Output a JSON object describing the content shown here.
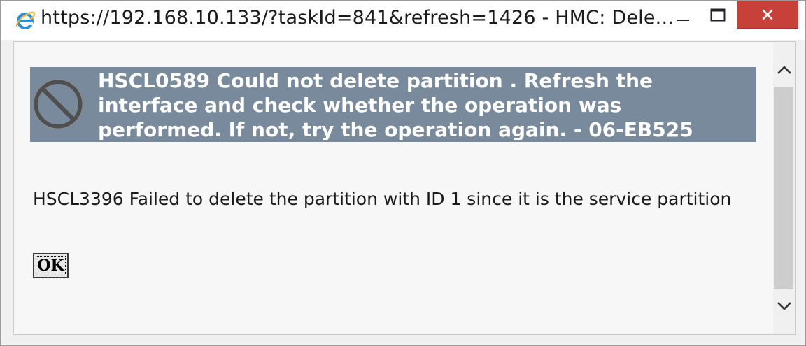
{
  "window": {
    "title": "https://192.168.10.133/?taskId=841&refresh=1426 - HMC: Dele...",
    "browser_icon": "internet-explorer-icon",
    "controls": {
      "minimize_icon": "minimize-icon",
      "maximize_icon": "maximize-icon",
      "close_icon": "close-icon"
    }
  },
  "error": {
    "icon": "prohibited-icon",
    "title": "HSCL0589 Could not delete partition . Refresh the interface and check whether the operation was performed. If not, try the operation again. - 06-EB525",
    "detail": " HSCL3396 Failed to delete the partition with ID 1 since it is the service partition"
  },
  "actions": {
    "ok_label": "OK"
  },
  "scrollbar": {
    "up_icon": "chevron-up-icon",
    "down_icon": "chevron-down-icon"
  },
  "colors": {
    "banner": "#788a9c",
    "close_button": "#c8403a",
    "content_bg": "#f7f7f7"
  }
}
